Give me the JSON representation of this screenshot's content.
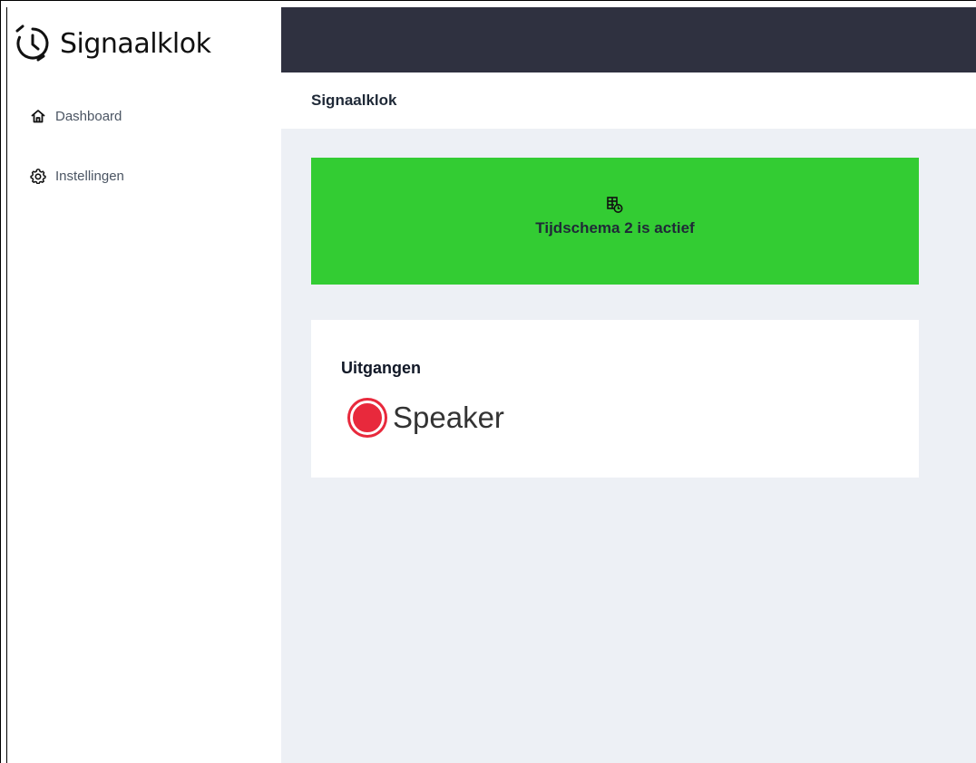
{
  "app": {
    "brand": "Signaalklok",
    "brand_icon": "clock-icon"
  },
  "sidebar": {
    "items": [
      {
        "label": "Dashboard",
        "icon": "home-icon"
      },
      {
        "label": "Instellingen",
        "icon": "gear-icon"
      }
    ]
  },
  "header": {
    "title": "Signaalklok"
  },
  "status": {
    "text": "Tijdschema 2 is actief",
    "icon": "schedule-clock-icon",
    "color": "#33cc33"
  },
  "outputs": {
    "heading": "Uitgangen",
    "items": [
      {
        "label": "Speaker",
        "state_color": "#e8293c",
        "icon": "status-indicator-icon"
      }
    ]
  },
  "colors": {
    "topbar": "#2f3140",
    "main_bg": "#edf0f5"
  }
}
